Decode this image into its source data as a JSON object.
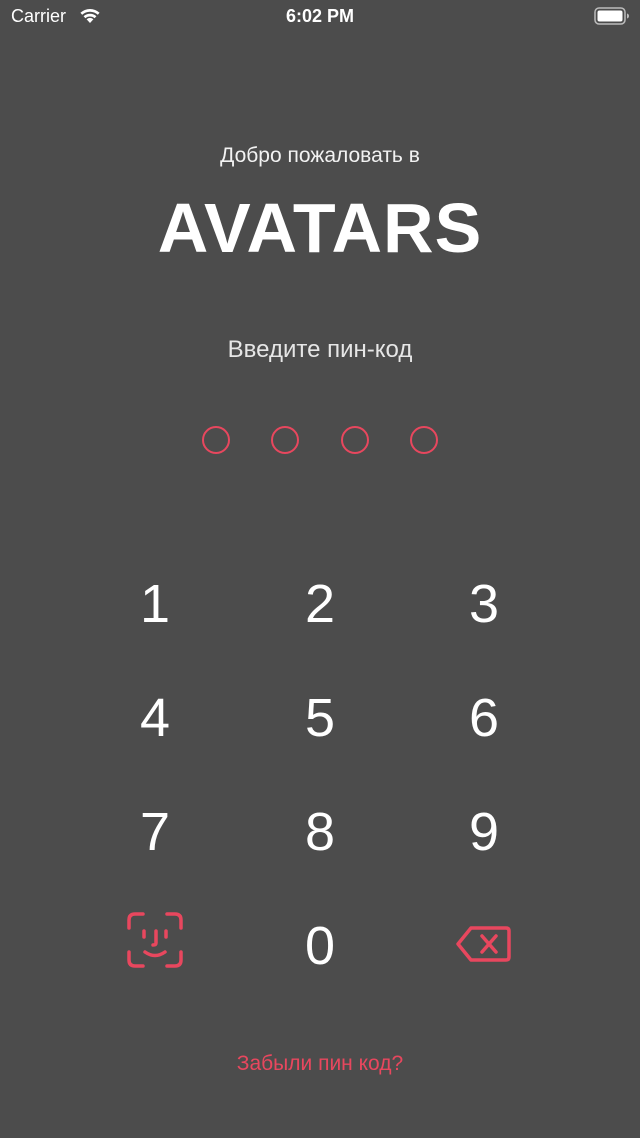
{
  "status_bar": {
    "carrier": "Carrier",
    "time": "6:02 PM"
  },
  "welcome": {
    "greeting": "Добро пожаловать в",
    "brand": "AVATARS"
  },
  "pin": {
    "prompt": "Введите пин-код",
    "entered_digits": 0,
    "length": 4
  },
  "keypad": {
    "keys": [
      "1",
      "2",
      "3",
      "4",
      "5",
      "6",
      "7",
      "8",
      "9",
      "0"
    ],
    "face_id_icon": "face-id-icon",
    "delete_icon": "backspace-icon"
  },
  "forgot_link": "Забыли пин код?",
  "colors": {
    "background": "#4c4c4c",
    "accent": "#e8475e",
    "text": "#ffffff"
  }
}
